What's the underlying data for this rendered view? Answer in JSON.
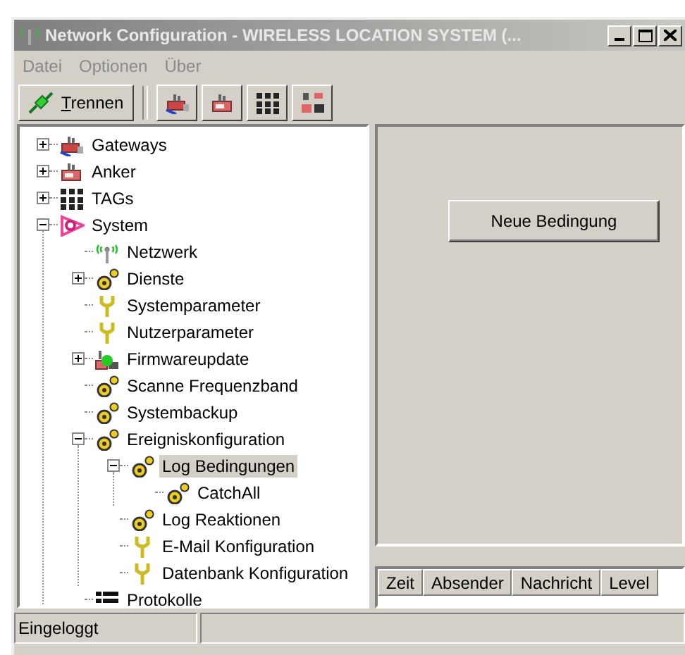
{
  "window": {
    "title": "Network Configuration - WIRELESS LOCATION SYSTEM  (..."
  },
  "menu": [
    "Datei",
    "Optionen",
    "Über"
  ],
  "toolbar": {
    "connect_button": "Trennen"
  },
  "tree": [
    {
      "label": "Gateways",
      "kind": "gateway",
      "expanded": false,
      "selected": false
    },
    {
      "label": "Anker",
      "kind": "anchor",
      "expanded": false,
      "selected": false
    },
    {
      "label": "TAGs",
      "kind": "tags",
      "expanded": false,
      "selected": false
    },
    {
      "label": "System",
      "kind": "system",
      "expanded": true,
      "selected": false,
      "children": [
        {
          "label": "Netzwerk",
          "kind": "network",
          "selected": false
        },
        {
          "label": "Dienste",
          "kind": "service",
          "expanded": false,
          "selected": false
        },
        {
          "label": "Systemparameter",
          "kind": "parameter",
          "selected": false
        },
        {
          "label": "Nutzerparameter",
          "kind": "parameter",
          "selected": false
        },
        {
          "label": "Firmwareupdate",
          "kind": "firmware",
          "expanded": false,
          "selected": false
        },
        {
          "label": "Scanne Frequenzband",
          "kind": "service",
          "selected": false
        },
        {
          "label": "Systembackup",
          "kind": "service",
          "selected": false
        },
        {
          "label": "Ereigniskonfiguration",
          "kind": "service",
          "expanded": true,
          "selected": false,
          "children": [
            {
              "label": "Log Bedingungen",
              "kind": "service",
              "expanded": true,
              "selected": true,
              "children": [
                {
                  "label": "CatchAll",
                  "kind": "service",
                  "selected": false
                }
              ]
            },
            {
              "label": "Log Reaktionen",
              "kind": "service",
              "selected": false
            },
            {
              "label": "E-Mail Konfiguration",
              "kind": "parameter",
              "selected": false
            },
            {
              "label": "Datenbank Konfiguration",
              "kind": "parameter",
              "selected": false
            }
          ]
        },
        {
          "label": "Protokolle",
          "kind": "list",
          "selected": false
        }
      ]
    }
  ],
  "action_button": "Neue Bedingung",
  "log_table": {
    "columns": [
      "Zeit",
      "Absender",
      "Nachricht",
      "Level"
    ]
  },
  "status_bar": [
    "Eingeloggt"
  ]
}
